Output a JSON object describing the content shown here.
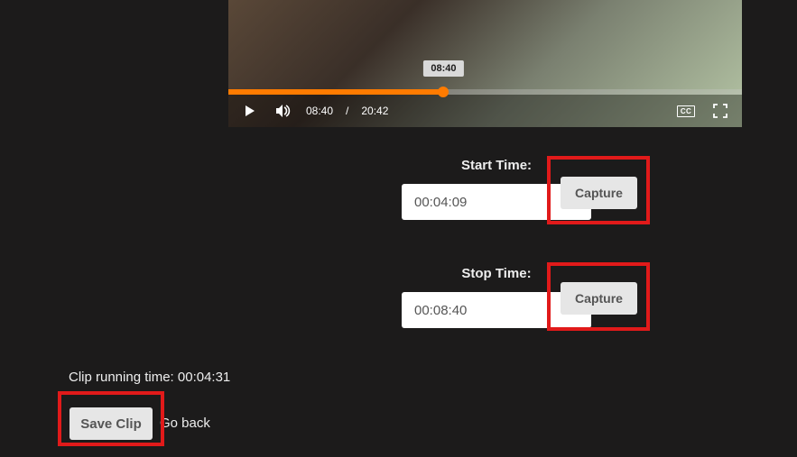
{
  "player": {
    "tooltip_time": "08:40",
    "current_time": "08:40",
    "time_separator": "/",
    "total_time": "20:42",
    "progress_percent": 41.9,
    "cc_label": "CC"
  },
  "start": {
    "label": "Start Time:",
    "value": "00:04:09",
    "capture_label": "Capture"
  },
  "stop": {
    "label": "Stop Time:",
    "value": "00:08:40",
    "capture_label": "Capture"
  },
  "running_time": {
    "prefix": "Clip running time: ",
    "value": "00:04:31"
  },
  "actions": {
    "save_label": "Save Clip",
    "go_back_label": "Go back"
  }
}
